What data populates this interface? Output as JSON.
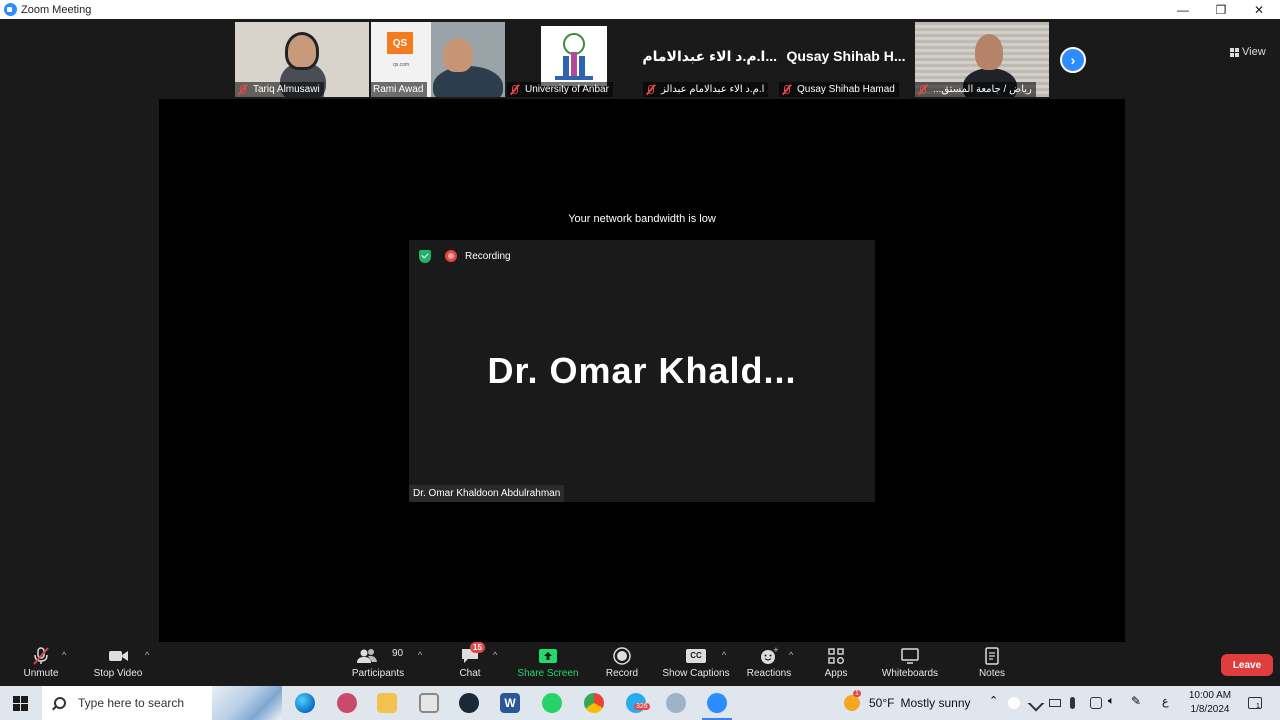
{
  "window": {
    "title": "Zoom Meeting",
    "controls": {
      "minimize": "—",
      "restore": "❐",
      "close": "✕"
    }
  },
  "gallery": {
    "tiles": [
      {
        "name": "Tariq Almusawi",
        "type": "video"
      },
      {
        "name": "Rami Awad",
        "type": "video"
      },
      {
        "name": "University of Anbar",
        "type": "logo"
      },
      {
        "name": "ا.م.د الاء عبدالامام عبدالز",
        "display": "...ا.م.د الاء عبدالامام",
        "type": "name"
      },
      {
        "name": "Qusay Shihab Hamad",
        "display": "Qusay Shihab H...",
        "type": "name"
      },
      {
        "name": "رياض / جامعة المستق...",
        "type": "video"
      }
    ],
    "qs_logo": "QS",
    "qs_sub": "qs.com",
    "next_arrow": "›",
    "view_label": "View"
  },
  "stage": {
    "bandwidth_notice": "Your network bandwidth is low",
    "recording_label": "Recording",
    "speaker_big_name": "Dr. Omar Khald...",
    "speaker_full_name": "Dr. Omar Khaldoon Abdulrahman"
  },
  "toolbar": {
    "unmute": "Unmute",
    "stop_video": "Stop Video",
    "participants": "Participants",
    "participants_count": "90",
    "chat": "Chat",
    "chat_badge": "15",
    "share_screen": "Share Screen",
    "record": "Record",
    "show_captions": "Show Captions",
    "cc": "CC",
    "reactions": "Reactions",
    "apps": "Apps",
    "whiteboards": "Whiteboards",
    "notes": "Notes",
    "leave": "Leave",
    "caret": "^"
  },
  "taskbar": {
    "search_placeholder": "Type here to search",
    "weather_temp": "50°F",
    "weather_desc": "Mostly sunny",
    "weather_badge": "1",
    "telegram_badge": "326",
    "lang": "ع",
    "time": "10:00 AM",
    "date": "1/8/2024",
    "notif_count": "1"
  },
  "colors": {
    "accent": "#2D8CFF",
    "leave": "#E03E3E",
    "share": "#23D96A",
    "muted": "#E04848"
  }
}
